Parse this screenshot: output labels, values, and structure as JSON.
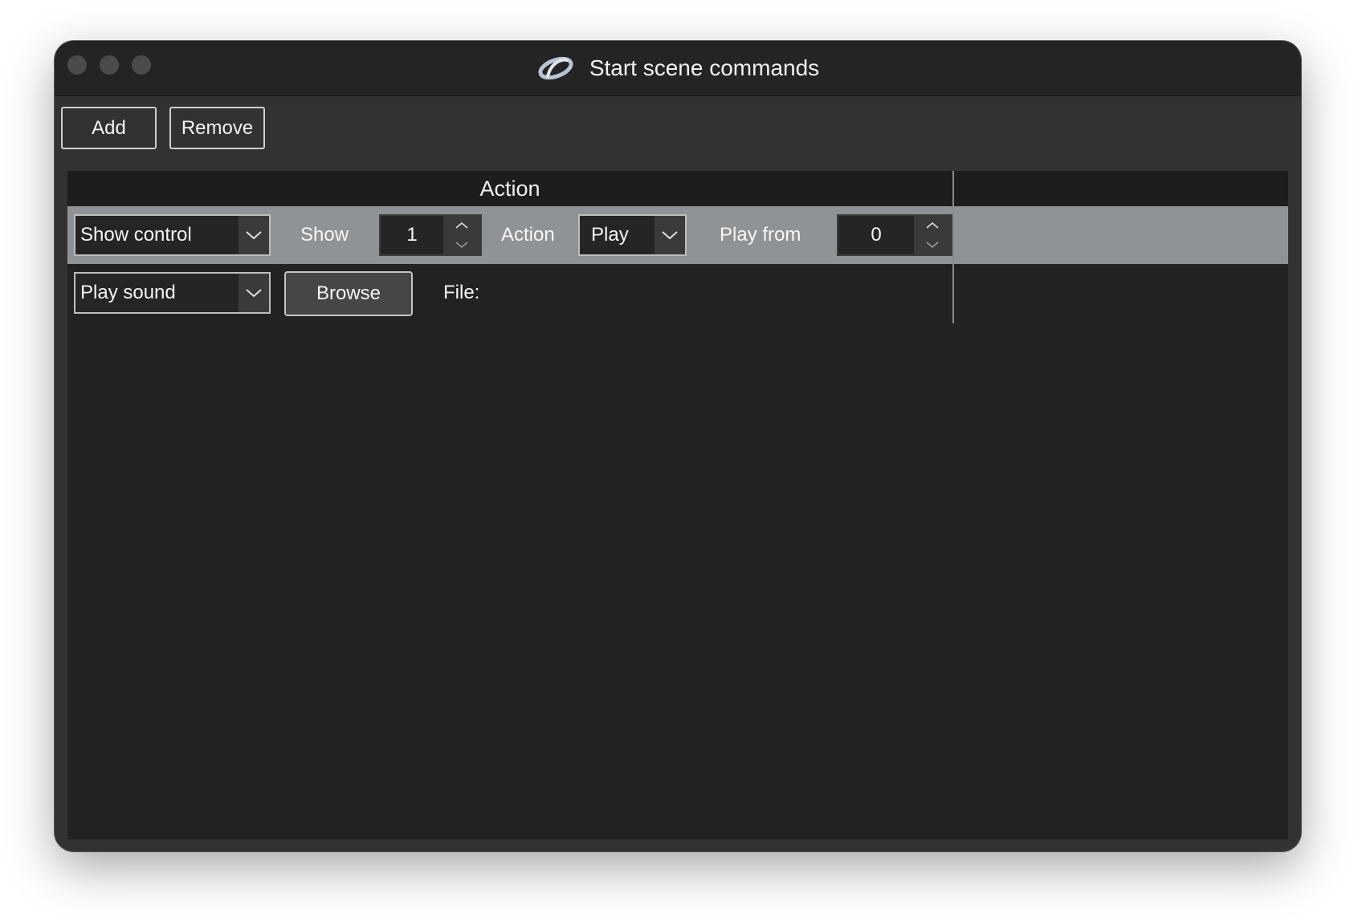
{
  "window": {
    "title": "Start scene commands"
  },
  "toolbar": {
    "add_label": "Add",
    "remove_label": "Remove"
  },
  "table": {
    "columns": [
      "Action",
      ""
    ],
    "rows": [
      {
        "command": "Show control",
        "show_label": "Show",
        "show_value": "1",
        "action_label": "Action",
        "action_value": "Play",
        "play_from_label": "Play from",
        "play_from_value": "0",
        "selected": true
      },
      {
        "command": "Play sound",
        "browse_label": "Browse",
        "file_label": "File:",
        "selected": false
      }
    ]
  },
  "colors": {
    "window_bg": "#323232",
    "titlebar_bg": "#242424",
    "table_bg": "#222222",
    "selected_row_bg": "#909396",
    "text": "#f4f4f4"
  }
}
